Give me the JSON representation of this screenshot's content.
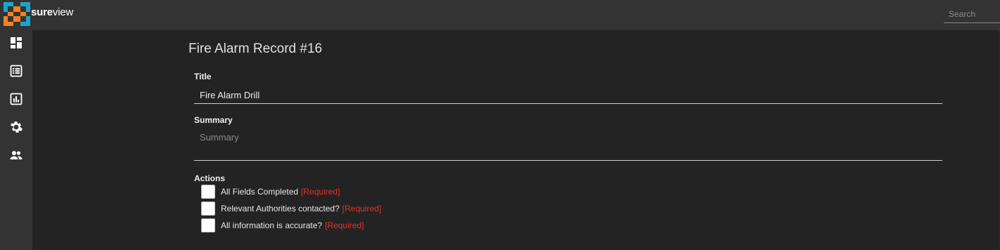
{
  "app": {
    "brand_bold": "sure",
    "brand_regular": "view",
    "brand_colors": {
      "orange": "#f58220",
      "teal": "#1ba6c9"
    }
  },
  "search": {
    "placeholder": "Search",
    "value": ""
  },
  "sidebar": {
    "items": [
      {
        "name": "dashboard-icon"
      },
      {
        "name": "list-icon"
      },
      {
        "name": "reports-icon"
      },
      {
        "name": "settings-icon"
      },
      {
        "name": "users-icon"
      }
    ]
  },
  "record": {
    "title": "Fire Alarm Record #16",
    "fields": {
      "title_label": "Title",
      "title_value": "Fire Alarm Drill",
      "summary_label": "Summary",
      "summary_placeholder": "Summary",
      "summary_value": ""
    },
    "actions_label": "Actions",
    "actions": [
      {
        "label": "All Fields Completed",
        "required": "[Required]",
        "checked": false
      },
      {
        "label": "Relevant Authorities contacted?",
        "required": "[Required]",
        "checked": false
      },
      {
        "label": "All information is accurate?",
        "required": "[Required]",
        "checked": false
      }
    ]
  },
  "colors": {
    "background": "#232323",
    "chrome": "#333333",
    "required": "#e0332b"
  }
}
